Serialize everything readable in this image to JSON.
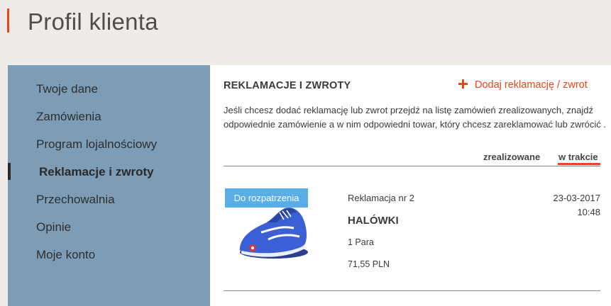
{
  "header": {
    "title": "Profil klienta"
  },
  "sidebar": {
    "items": [
      {
        "label": "Twoje dane"
      },
      {
        "label": "Zamówienia"
      },
      {
        "label": "Program lojalnościowy"
      },
      {
        "label": "Reklamacje i zwroty",
        "active": true
      },
      {
        "label": "Przechowalnia"
      },
      {
        "label": "Opinie"
      },
      {
        "label": "Moje konto"
      }
    ]
  },
  "main": {
    "title": "REKLAMACJE I ZWROTY",
    "add_link": "Dodaj reklamację / zwrot",
    "info": "Jeśli chcesz dodać reklamację lub zwrot przejdź na listę zamówień zrealizowanych, znajdź odpowiednie zamówienie a w nim odpowiedni towar, który chcesz zareklamować lub zwrócić .",
    "tabs": [
      {
        "label": "zrealizowane",
        "active": false
      },
      {
        "label": "w trakcie",
        "active": true
      }
    ],
    "claims": [
      {
        "status": "Do rozpatrzenia",
        "number": "Reklamacja nr 2",
        "product": "HALÓWKI",
        "quantity": "1 Para",
        "price": "71,55 PLN",
        "date": "23-03-2017",
        "time": "10:48",
        "image_icon": "blue-sneaker-icon"
      }
    ]
  },
  "colors": {
    "accent": "#e8461b",
    "sidebar_bg": "#7d9db6",
    "badge_bg": "#5aaee8",
    "page_bg": "#efebe7"
  }
}
